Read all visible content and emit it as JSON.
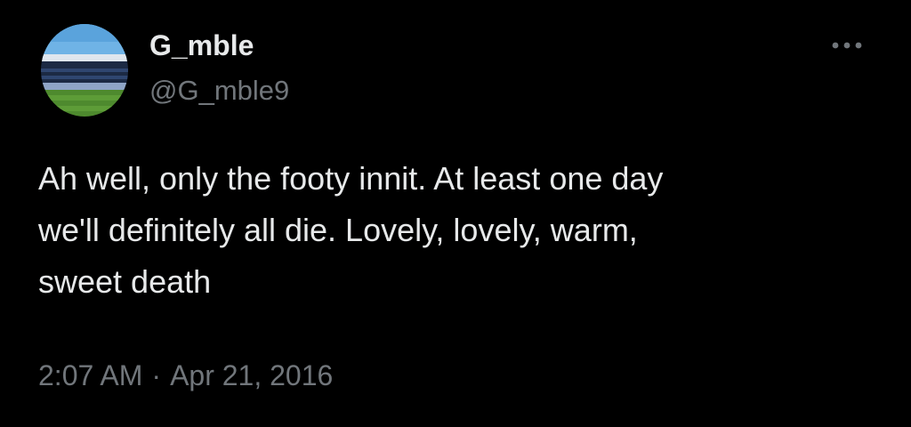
{
  "account": {
    "display_name": "G_mble",
    "handle": "@G_mble9"
  },
  "tweet": {
    "text_lines": [
      "Ah well, only the footy innit. At least one day",
      "we'll definitely all die. Lovely, lovely, warm,",
      "sweet death"
    ],
    "time": "2:07 AM",
    "separator": "·",
    "date": "Apr 21, 2016"
  },
  "icons": {
    "avatar": "stadium-photo-avatar",
    "more": "more-options-icon"
  },
  "colors": {
    "background": "#000000",
    "primary_text": "#e7e9ea",
    "secondary_text": "#71767b"
  }
}
